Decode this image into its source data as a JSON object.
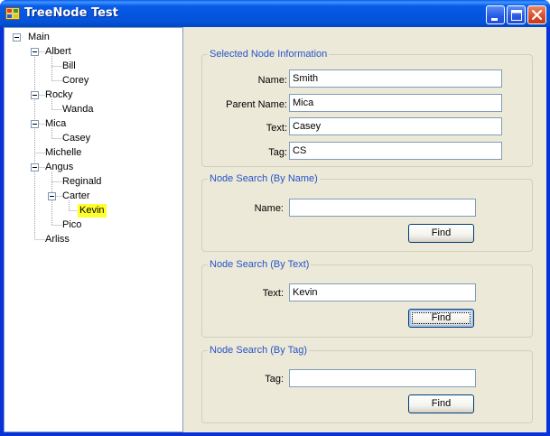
{
  "window": {
    "title": "TreeNode Test",
    "minimize_icon": "minimize-icon",
    "maximize_icon": "maximize-icon",
    "close_icon": "close-icon",
    "app_icon": "app-window-icon"
  },
  "tree": {
    "nodes": [
      {
        "text": "Main",
        "expanded": true,
        "selected": false
      },
      {
        "text": "Albert",
        "expanded": true,
        "selected": false
      },
      {
        "text": "Bill",
        "selected": false
      },
      {
        "text": "Corey",
        "selected": false
      },
      {
        "text": "Rocky",
        "expanded": true,
        "selected": false
      },
      {
        "text": "Wanda",
        "selected": false
      },
      {
        "text": "Mica",
        "expanded": true,
        "selected": false
      },
      {
        "text": "Casey",
        "selected": false
      },
      {
        "text": "Michelle",
        "selected": false
      },
      {
        "text": "Angus",
        "expanded": true,
        "selected": false
      },
      {
        "text": "Reginald",
        "selected": false
      },
      {
        "text": "Carter",
        "expanded": true,
        "selected": false
      },
      {
        "text": "Kevin",
        "selected": true
      },
      {
        "text": "Pico",
        "selected": false
      },
      {
        "text": "Arliss",
        "selected": false
      }
    ],
    "highlight_color": "#ffff2e"
  },
  "selected_info": {
    "title": "Selected Node Information",
    "name_label": "Name:",
    "name_value": "Smith",
    "parent_label": "Parent Name:",
    "parent_value": "Mica",
    "text_label": "Text:",
    "text_value": "Casey",
    "tag_label": "Tag:",
    "tag_value": "CS"
  },
  "search_name": {
    "title": "Node Search (By Name)",
    "label": "Name:",
    "value": "",
    "button": "Find"
  },
  "search_text": {
    "title": "Node Search (By Text)",
    "label": "Text:",
    "value": "Kevin",
    "button": "Find"
  },
  "search_tag": {
    "title": "Node Search (By Tag)",
    "label": "Tag:",
    "value": "",
    "button": "Find"
  },
  "colors": {
    "titlebar": "#0a5ce8",
    "group_title": "#2654c8",
    "client_bg": "#ece9d8"
  }
}
